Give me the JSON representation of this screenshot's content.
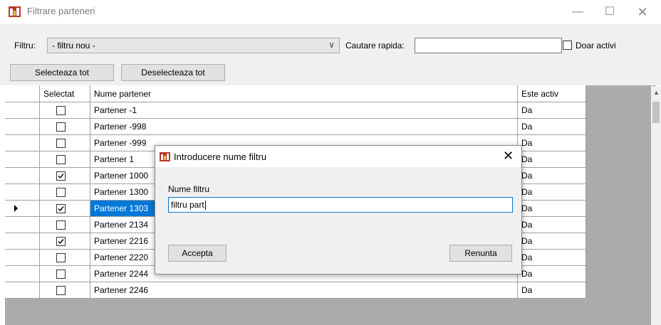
{
  "window": {
    "title": "Filtrare parteneri",
    "minimize_glyph": "—",
    "maximize_glyph": "☐",
    "close_glyph": "✕"
  },
  "filter": {
    "label": "Filtru:",
    "selected": "- filtru nou -",
    "quick_search_label": "Cautare rapida:",
    "quick_search_value": "",
    "only_active_label": "Doar activi",
    "only_active_checked": false
  },
  "buttons": {
    "select_all": "Selecteaza tot",
    "deselect_all": "Deselecteaza tot"
  },
  "grid": {
    "headers": [
      "Selectat",
      "Nume partener",
      "Este activ"
    ],
    "rows": [
      {
        "selected": false,
        "name": "Partener -1",
        "active": "Da"
      },
      {
        "selected": false,
        "name": "Partener -998",
        "active": "Da"
      },
      {
        "selected": false,
        "name": "Partener -999",
        "active": "Da"
      },
      {
        "selected": false,
        "name": "Partener 1",
        "active": "Da"
      },
      {
        "selected": true,
        "name": "Partener 1000",
        "active": "Da"
      },
      {
        "selected": false,
        "name": "Partener 1300",
        "active": "Da"
      },
      {
        "selected": true,
        "name": "Partener 1303",
        "active": "Da",
        "current": true
      },
      {
        "selected": false,
        "name": "Partener 2134",
        "active": "Da"
      },
      {
        "selected": true,
        "name": "Partener 2216",
        "active": "Da"
      },
      {
        "selected": false,
        "name": "Partener 2220",
        "active": "Da"
      },
      {
        "selected": false,
        "name": "Partener 2244",
        "active": "Da"
      },
      {
        "selected": false,
        "name": "Partener 2246",
        "active": "Da"
      }
    ]
  },
  "dialog": {
    "title": "Introducere nume filtru",
    "field_label": "Nume filtru",
    "field_value": "filtru part",
    "accept": "Accepta",
    "cancel": "Renunta",
    "close_glyph": "✕"
  },
  "icons": {
    "app": "app-logo-icon",
    "combo_arrow": "chevron-down-icon",
    "row_indicator": "current-row-arrow-icon",
    "scroll_up": "scroll-up-arrow-icon"
  },
  "colors": {
    "selection": "#0078d7",
    "grid_background": "#ababab",
    "form_background": "#f0f0f0"
  }
}
